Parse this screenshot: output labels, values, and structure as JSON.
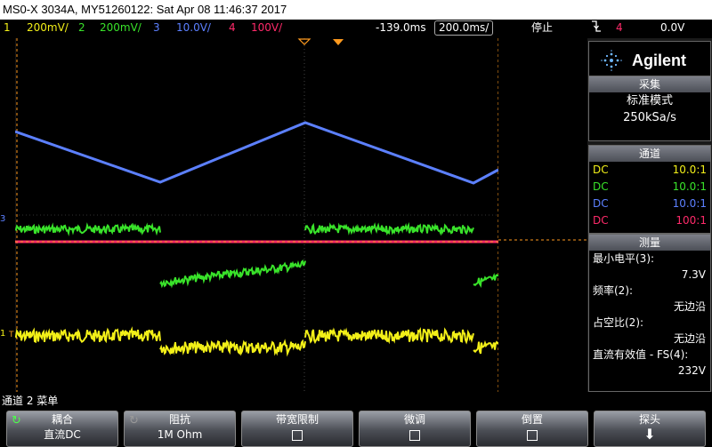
{
  "title": "MS0-X 3034A, MY51260122: Sat Apr 08 11:46:37 2017",
  "status": {
    "ch1_num": "1",
    "ch1_scale": "200mV/",
    "ch2_num": "2",
    "ch2_scale": "200mV/",
    "ch3_num": "3",
    "ch3_scale": "10.0V/",
    "ch4_num": "4",
    "ch4_scale": "100V/",
    "delay": "-139.0ms",
    "timebase": "200.0ms/",
    "run_state": "停止",
    "trigger_icon": "trigger-edge-falling-icon",
    "trigger_source": "4",
    "trigger_level": "0.0V"
  },
  "markers": {
    "ch3": "3",
    "ch1": "1",
    "trig": "T"
  },
  "logo": "Agilent",
  "acquisition": {
    "header": "采集",
    "mode": "标准模式",
    "rate": "250kSa/s"
  },
  "channels": {
    "header": "通道",
    "rows": [
      {
        "coupling": "DC",
        "probe": "10.0:1",
        "color": "#f2ef18"
      },
      {
        "coupling": "DC",
        "probe": "10.0:1",
        "color": "#39e22a"
      },
      {
        "coupling": "DC",
        "probe": "10.0:1",
        "color": "#5c80ff"
      },
      {
        "coupling": "DC",
        "probe": "100:1",
        "color": "#ff2a6a"
      }
    ]
  },
  "measurements": {
    "header": "测量",
    "items": [
      {
        "name": "最小电平(3):",
        "value": "7.3V"
      },
      {
        "name": "频率(2):",
        "value": "无边沿"
      },
      {
        "name": "占空比(2):",
        "value": "无边沿"
      },
      {
        "name": "直流有效值 - FS(4):",
        "value": "232V"
      }
    ]
  },
  "menu_title": "通道 2 菜单",
  "softkeys": [
    {
      "label": "耦合",
      "value": "直流DC",
      "icon": "rotate-knob-icon"
    },
    {
      "label": "阻抗",
      "value": "1M Ohm",
      "icon": "rotate-knob-icon"
    },
    {
      "label": "带宽限制",
      "value": ""
    },
    {
      "label": "微调",
      "value": ""
    },
    {
      "label": "倒置",
      "value": ""
    },
    {
      "label": "探头",
      "value": ""
    }
  ],
  "colors": {
    "ch1": "#f2ef18",
    "ch2": "#39e22a",
    "ch3": "#5c80ff",
    "ch4": "#ff2a6a",
    "cursor": "#ff9a1e"
  }
}
